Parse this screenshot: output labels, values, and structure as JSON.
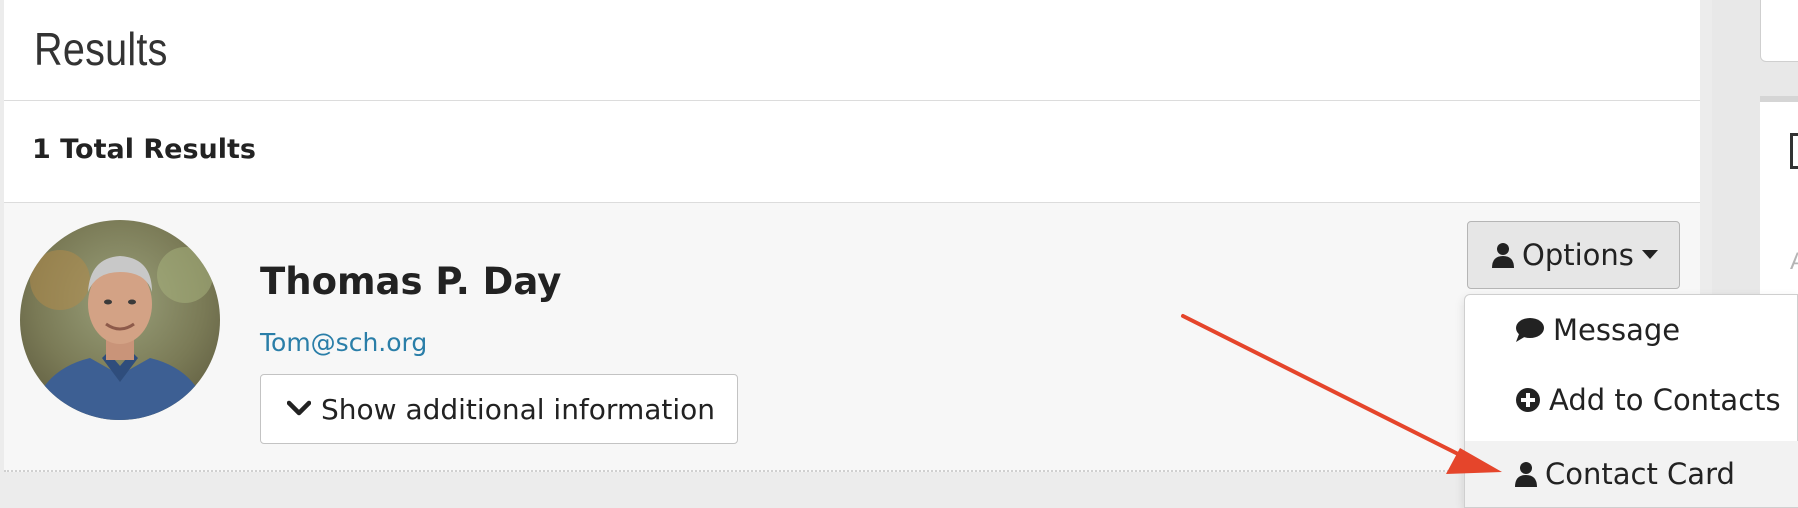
{
  "results": {
    "title": "Results",
    "total_label": "1 Total Results"
  },
  "person": {
    "name": "Thomas P. Day",
    "email": "Tom@sch.org",
    "show_info_label": "Show additional information"
  },
  "options": {
    "label": "Options",
    "menu": [
      {
        "label": "Message",
        "icon": "comment-icon"
      },
      {
        "label": "Add to Contacts",
        "icon": "plus-circle-icon"
      },
      {
        "label": "Contact Card",
        "icon": "user-icon"
      }
    ]
  },
  "colors": {
    "link": "#2a7ea8",
    "annotation_arrow": "#e5452b",
    "hover_bg": "#f2f2f2"
  }
}
